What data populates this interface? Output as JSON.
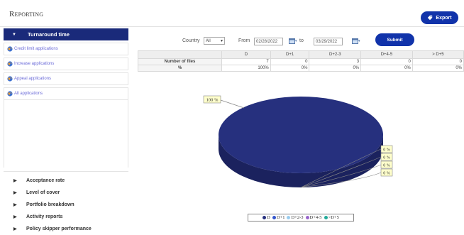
{
  "header": {
    "title": "Reporting",
    "export_label": "Export"
  },
  "colors": {
    "primary": "#1133aa",
    "nav_active": "#1a2a7a",
    "pie_dark": "#26307e",
    "pie_side": "#1b225e",
    "label_bg": "#ffffcc"
  },
  "sidebar": {
    "active_section": "Turnaround time",
    "sub_items": [
      {
        "label": "Credit limit applications",
        "icon": "globe-icon"
      },
      {
        "label": "Increase applications",
        "icon": "globe-icon"
      },
      {
        "label": "Appeal applications",
        "icon": "globe-icon"
      },
      {
        "label": "All applications",
        "icon": "globe-icon"
      }
    ],
    "sections": [
      {
        "label": "Acceptance rate"
      },
      {
        "label": "Level of cover"
      },
      {
        "label": "Portfolio breakdown"
      },
      {
        "label": "Activity reports"
      },
      {
        "label": "Policy skipper performance"
      }
    ]
  },
  "filters": {
    "country_label": "Country",
    "country_value": "All",
    "from_label": "From",
    "from_date": "02/28/2022",
    "to_label": "to",
    "to_date": "03/29/2022",
    "submit_label": "Submit"
  },
  "table": {
    "columns": [
      "D",
      "D+1",
      "D+2-3",
      "D+4-5",
      "> D+5"
    ],
    "rows": [
      {
        "label": "Number of files",
        "values": [
          "7",
          "0",
          "3",
          "0",
          "0"
        ]
      },
      {
        "label": "%",
        "values": [
          "100%",
          "0%",
          "0%",
          "0%",
          "0%"
        ]
      }
    ]
  },
  "chart_data": {
    "type": "pie",
    "categories": [
      "D",
      "D+1",
      "D+2-3",
      "D+4-5",
      ">D+5"
    ],
    "values": [
      100,
      0,
      0,
      0,
      0
    ],
    "data_labels": [
      "100 %",
      "0 %",
      "0 %",
      "0 %",
      "0 %"
    ],
    "legend_colors": [
      "#26307e",
      "#3355cc",
      "#99ccee",
      "#9966cc",
      "#22aa99"
    ],
    "legend": "bottom"
  }
}
